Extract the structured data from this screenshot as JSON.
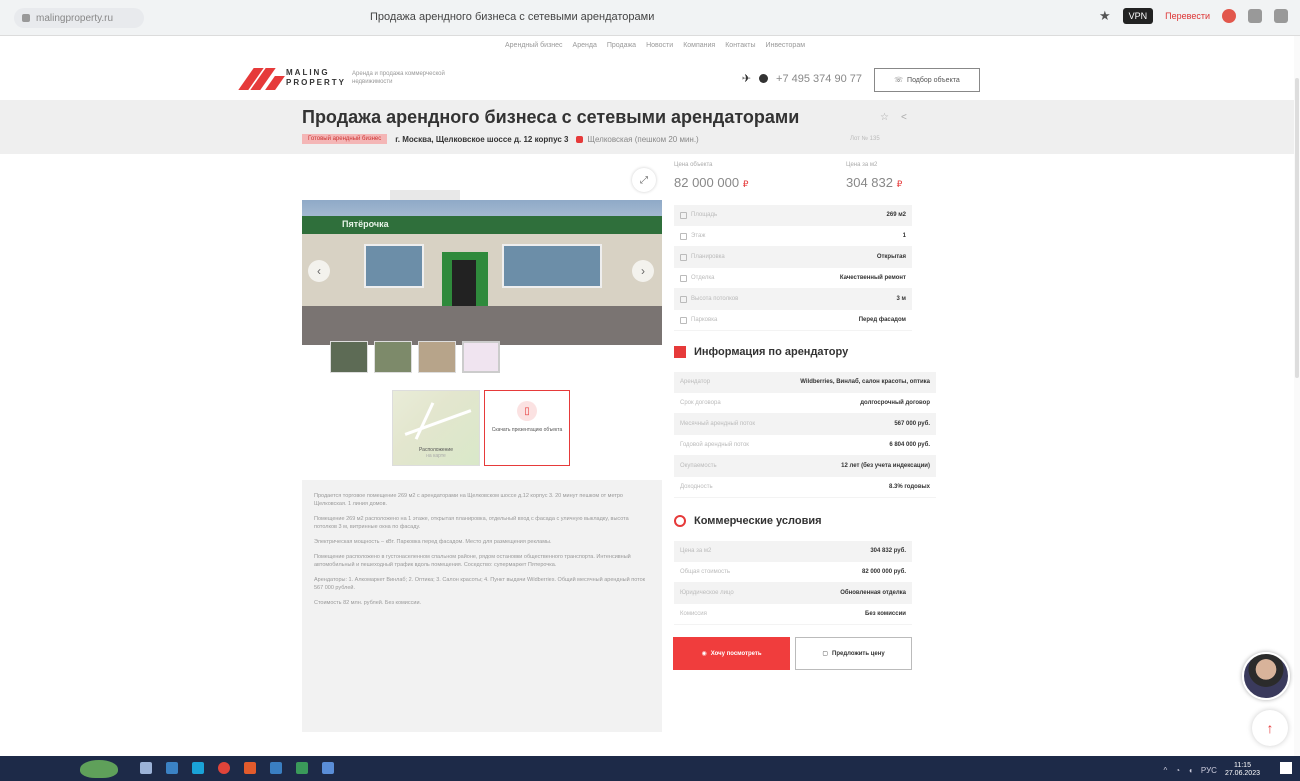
{
  "browser": {
    "url": "malingproperty.ru",
    "tab_title": "Продажа арендного бизнеса с сетевыми арендаторами",
    "vpn": "VPN",
    "translate": "Перевести"
  },
  "nav": {
    "items": [
      "Арендный бизнес",
      "Аренда",
      "Продажа",
      "Новости",
      "Компания",
      "Контакты",
      "Инвесторам"
    ]
  },
  "header": {
    "logo_line1": "MALING",
    "logo_line2": "PROPERTY",
    "tagline": "Аренда и продажа коммерческой недвижимости",
    "phone": "+7 495 374 90 77",
    "call_button": "Подбор объекта"
  },
  "listing": {
    "title": "Продажа арендного бизнеса с сетевыми арендаторами",
    "tag": "Готовый арендный бизнес",
    "address": "г. Москва, Щелковское шоссе д. 12 корпус 3",
    "metro": "Щелковская (пешком 20 мин.)",
    "lot_id": "Лот № 135",
    "price_label": "Цена объекта",
    "price": "82 000 000",
    "price_m2_label": "Цена за м2",
    "price_m2": "304 832",
    "currency_symbol": "₽",
    "sign_text": "Пятёрочка",
    "map_label": "Расположение",
    "map_sub": "на карте",
    "presentation_label": "Скачать презентацию объекта"
  },
  "params": [
    {
      "key": "Площадь",
      "value": "269 м2",
      "icon": "area-icon"
    },
    {
      "key": "Этаж",
      "value": "1",
      "icon": "floor-icon"
    },
    {
      "key": "Планировка",
      "value": "Открытая",
      "icon": "layout-icon"
    },
    {
      "key": "Отделка",
      "value": "Качественный ремонт",
      "icon": "finish-icon"
    },
    {
      "key": "Высота потолков",
      "value": "3 м",
      "icon": "height-icon"
    },
    {
      "key": "Парковка",
      "value": "Перед фасадом",
      "icon": "parking-icon"
    }
  ],
  "tenant_section": {
    "heading": "Информация по арендатору",
    "rows": [
      {
        "key": "Арендатор",
        "value": "Wildberries, Винлаб, салон красоты, оптика"
      },
      {
        "key": "Срок договора",
        "value": "долгосрочный договор"
      },
      {
        "key": "Месячный арендный поток",
        "value": "567 000 руб."
      },
      {
        "key": "Годовой арендный поток",
        "value": "6 804 000 руб."
      },
      {
        "key": "Окупаемость",
        "value": "12 лет (без учета индексации)"
      },
      {
        "key": "Доходность",
        "value": "8.3% годовых"
      }
    ]
  },
  "conditions_section": {
    "heading": "Коммерческие условия",
    "rows": [
      {
        "key": "Цена за м2",
        "value": "304 832 руб."
      },
      {
        "key": "Общая стоимость",
        "value": "82 000 000 руб."
      },
      {
        "key": "Юридическое лицо",
        "value": "Обновленная отделка"
      },
      {
        "key": "Комиссия",
        "value": "Без комиссии"
      }
    ]
  },
  "buttons": {
    "primary": "Хочу посмотреть",
    "secondary": "Предложить цену"
  },
  "description": [
    "Продается торговое помещение 269 м2 с арендаторами на Щелковском шоссе д.12 корпус 3. 20 минут пешком от метро Щелковская. 1 линия домов.",
    "Помещение 269 м2 расположено на 1 этаже, открытая планировка, отдельный вход с фасада с уличную выкладку, высота потолков 3 м, витринные окна по фасаду.",
    "Электрическая мощность – кВт. Парковка перед фасадом. Место для размещения рекламы.",
    "Помещение расположено в густонаселенном спальном районе, рядом остановки общественного транспорта. Интенсивный автомобильный и пешеходный трафик вдоль помещения. Соседство: супермаркет Пятерочка.",
    "Арендаторы: 1. Алкомаркет Винлаб; 2. Оптика; 3. Салон красоты; 4. Пункт выдачи Wildberries. Общий месячный арендный поток 567 000 рублей.",
    "Стоимость 82 млн. рублей. Без комиссии."
  ],
  "taskbar": {
    "lang": "РУС",
    "time": "11:15",
    "date": "27.06.2023"
  },
  "colors": {
    "accent": "#e63a3a",
    "taskbar": "#1d2a48"
  }
}
